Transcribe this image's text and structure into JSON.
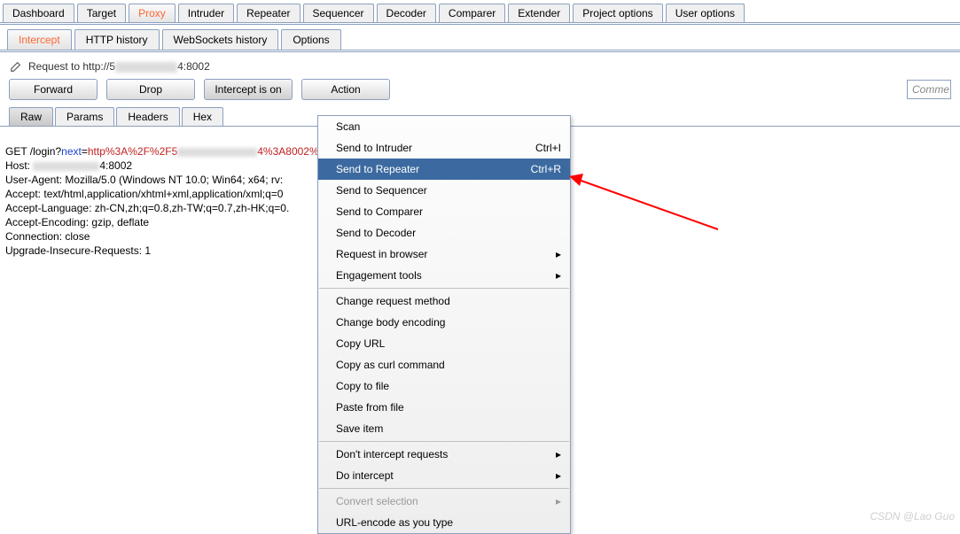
{
  "main_tabs": [
    "Dashboard",
    "Target",
    "Proxy",
    "Intruder",
    "Repeater",
    "Sequencer",
    "Decoder",
    "Comparer",
    "Extender",
    "Project options",
    "User options"
  ],
  "main_tabs_active": 2,
  "sub_tabs": [
    "Intercept",
    "HTTP history",
    "WebSockets history",
    "Options"
  ],
  "sub_tabs_active": 0,
  "request_bar_prefix": "Request to http://5",
  "request_bar_suffix": "4:8002",
  "buttons": {
    "forward": "Forward",
    "drop": "Drop",
    "intercept": "Intercept is on",
    "action": "Action"
  },
  "comment_placeholder": "Comme",
  "view_tabs": [
    "Raw",
    "Params",
    "Headers",
    "Hex"
  ],
  "view_tabs_active": 0,
  "request_lines": {
    "l1a": "GET /login?",
    "l1b": "next",
    "l1c": "=",
    "l1d": "http%3A%2F%2F5",
    "l1e": "4%3A8002%",
    "l2a": "Host: ",
    "l2b": "4:8002",
    "l3": "User-Agent: Mozilla/5.0 (Windows NT 10.0; Win64; x64; rv:",
    "l4": "Accept: text/html,application/xhtml+xml,application/xml;q=0",
    "l5": "Accept-Language: zh-CN,zh;q=0.8,zh-TW;q=0.7,zh-HK;q=0.",
    "l6": "Accept-Encoding: gzip, deflate",
    "l7": "Connection: close",
    "l8": "Upgrade-Insecure-Requests: 1"
  },
  "ctx_menu": [
    {
      "label": "Scan",
      "type": "item"
    },
    {
      "label": "Send to Intruder",
      "shortcut": "Ctrl+I",
      "type": "item"
    },
    {
      "label": "Send to Repeater",
      "shortcut": "Ctrl+R",
      "type": "item",
      "highlight": true
    },
    {
      "label": "Send to Sequencer",
      "type": "item"
    },
    {
      "label": "Send to Comparer",
      "type": "item"
    },
    {
      "label": "Send to Decoder",
      "type": "item"
    },
    {
      "label": "Request in browser",
      "type": "submenu"
    },
    {
      "label": "Engagement tools",
      "type": "submenu"
    },
    {
      "type": "sep"
    },
    {
      "label": "Change request method",
      "type": "item"
    },
    {
      "label": "Change body encoding",
      "type": "item"
    },
    {
      "label": "Copy URL",
      "type": "item"
    },
    {
      "label": "Copy as curl command",
      "type": "item"
    },
    {
      "label": "Copy to file",
      "type": "item"
    },
    {
      "label": "Paste from file",
      "type": "item"
    },
    {
      "label": "Save item",
      "type": "item"
    },
    {
      "type": "sep"
    },
    {
      "label": "Don't intercept requests",
      "type": "submenu"
    },
    {
      "label": "Do intercept",
      "type": "submenu"
    },
    {
      "type": "sep"
    },
    {
      "label": "Convert selection",
      "type": "submenu",
      "disabled": true
    },
    {
      "label": "URL-encode as you type",
      "type": "item"
    }
  ],
  "watermark": "CSDN @Lao Guo"
}
